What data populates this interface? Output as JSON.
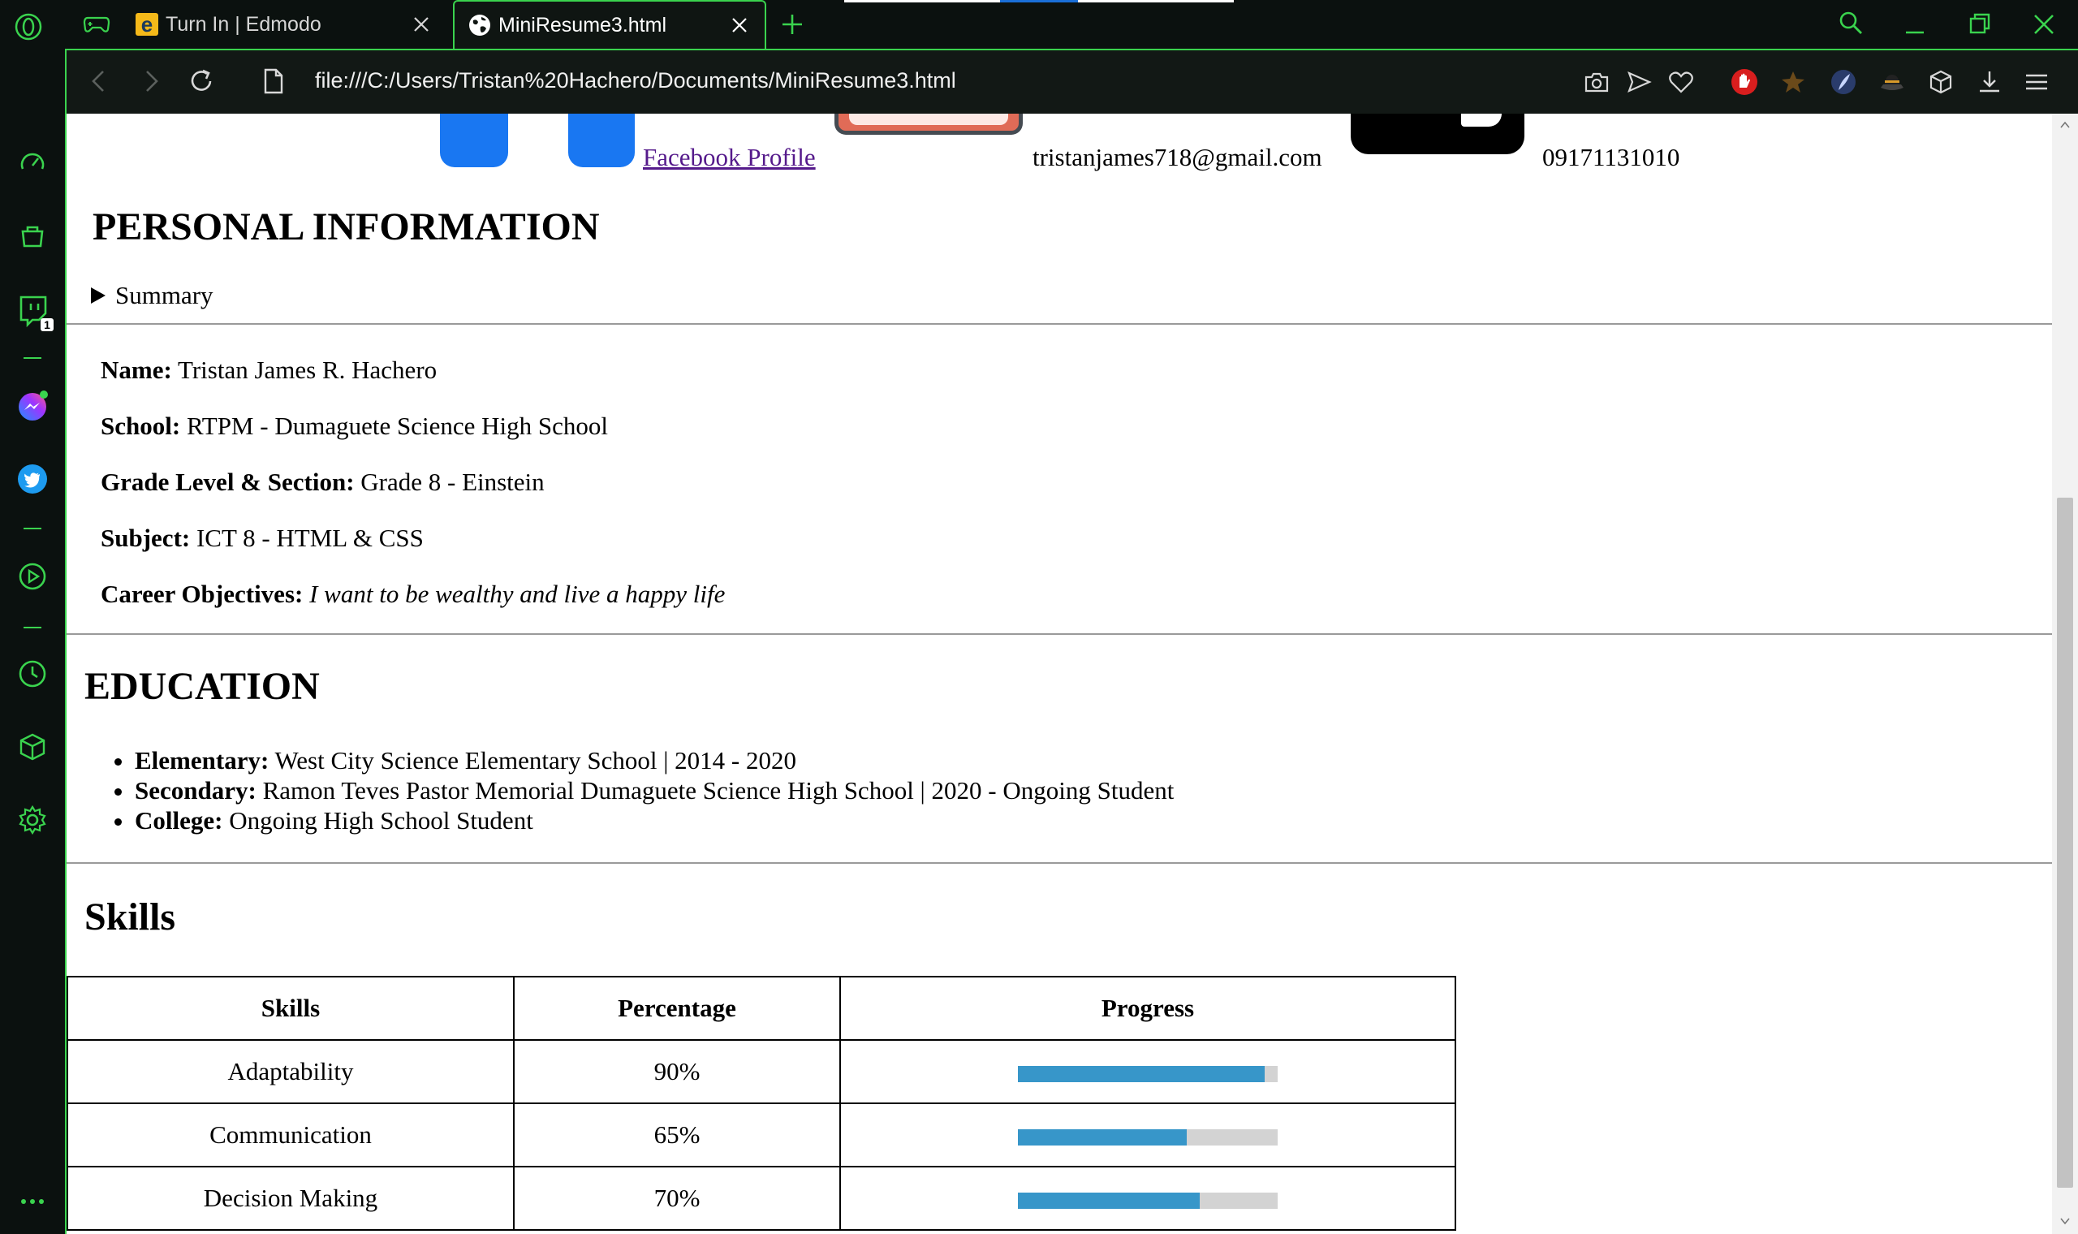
{
  "browser": {
    "tabs": [
      {
        "title": "Turn In | Edmodo",
        "icon": "edmodo-e-icon"
      },
      {
        "title": "MiniResume3.html",
        "icon": "globe-icon",
        "active": true
      }
    ],
    "url": "file:///C:/Users/Tristan%20Hachero/Documents/MiniResume3.html",
    "accent": "#3ad34e",
    "sidebar_badge": "1"
  },
  "page": {
    "contact": {
      "facebook_link": "Facebook Profile",
      "email": "tristanjames718@gmail.com",
      "phone": "09171131010"
    },
    "personal": {
      "heading": "PERSONAL INFORMATION",
      "summary": "Summary",
      "name_label": "Name:",
      "name_value": "Tristan James R. Hachero",
      "school_label": "School:",
      "school_value": "RTPM - Dumaguete Science High School",
      "grade_label": "Grade Level & Section:",
      "grade_value": "Grade 8 - Einstein",
      "subject_label": "Subject:",
      "subject_value": "ICT 8 - HTML & CSS",
      "objective_label": "Career Objectives:",
      "objective_value": "I want to be wealthy and live a happy life"
    },
    "education": {
      "heading": "EDUCATION",
      "items": [
        {
          "label": "Elementary:",
          "value": "West City Science Elementary School | 2014 - 2020"
        },
        {
          "label": "Secondary:",
          "value": "Ramon Teves Pastor Memorial Dumaguete Science High School | 2020 - Ongoing Student"
        },
        {
          "label": "College:",
          "value": "Ongoing High School Student"
        }
      ]
    },
    "skills": {
      "heading": "Skills",
      "headers": [
        "Skills",
        "Percentage",
        "Progress"
      ],
      "rows": [
        {
          "skill": "Adaptability",
          "percent": "90%",
          "progress": 0.95
        },
        {
          "skill": "Communication",
          "percent": "65%",
          "progress": 0.65
        },
        {
          "skill": "Decision Making",
          "percent": "70%",
          "progress": 0.7
        }
      ],
      "bar_color": "#3796c9",
      "track_color": "#d3d3d3"
    }
  }
}
